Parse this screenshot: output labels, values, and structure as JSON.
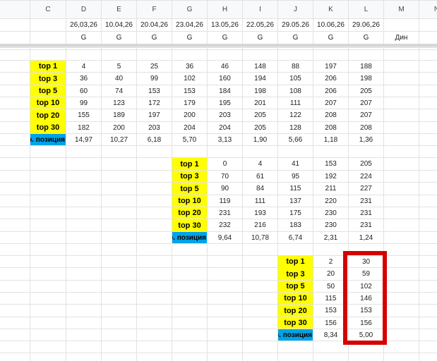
{
  "columns": [
    "C",
    "D",
    "E",
    "F",
    "G",
    "H",
    "I",
    "J",
    "K",
    "L",
    "M",
    "N"
  ],
  "dates": [
    "26,03,26",
    "10.04,26",
    "20.04,26",
    "23.04,26",
    "13.05,26",
    "22.05,26",
    "29.05.26",
    "10.06,26",
    "29.06,26"
  ],
  "engine_row": [
    "G",
    "G",
    "G",
    "G",
    "G",
    "G",
    "G",
    "G",
    "G"
  ],
  "dyn_label": "Дин",
  "labels": [
    "top 1",
    "top 3",
    "top 5",
    "top 10",
    "top 20",
    "top 30"
  ],
  "avg_label": "Ср. позиция",
  "block1": {
    "rows": [
      [
        "4",
        "5",
        "25",
        "36",
        "46",
        "148",
        "88",
        "197",
        "188"
      ],
      [
        "36",
        "40",
        "99",
        "102",
        "160",
        "194",
        "105",
        "206",
        "198"
      ],
      [
        "60",
        "74",
        "153",
        "153",
        "184",
        "198",
        "108",
        "206",
        "205"
      ],
      [
        "99",
        "123",
        "172",
        "179",
        "195",
        "201",
        "111",
        "207",
        "207"
      ],
      [
        "155",
        "189",
        "197",
        "200",
        "203",
        "205",
        "122",
        "208",
        "207"
      ],
      [
        "182",
        "200",
        "203",
        "204",
        "204",
        "205",
        "128",
        "208",
        "208"
      ]
    ],
    "avg": [
      "14,97",
      "10,27",
      "6,18",
      "5,70",
      "3,13",
      "1,90",
      "5,66",
      "1,18",
      "1,36"
    ]
  },
  "block2": {
    "rows": [
      [
        "0",
        "4",
        "41",
        "153",
        "205"
      ],
      [
        "70",
        "61",
        "95",
        "192",
        "224"
      ],
      [
        "90",
        "84",
        "115",
        "211",
        "227"
      ],
      [
        "119",
        "111",
        "137",
        "220",
        "231"
      ],
      [
        "231",
        "193",
        "175",
        "230",
        "231"
      ],
      [
        "232",
        "216",
        "183",
        "230",
        "231"
      ]
    ],
    "avg": [
      "9,64",
      "10,78",
      "6,74",
      "2,31",
      "1,24"
    ]
  },
  "block3": {
    "rows": [
      [
        "2",
        "30"
      ],
      [
        "20",
        "59"
      ],
      [
        "50",
        "102"
      ],
      [
        "115",
        "146"
      ],
      [
        "153",
        "153"
      ],
      [
        "156",
        "156"
      ]
    ],
    "avg": [
      "8,34",
      "5,00"
    ]
  },
  "colors": {
    "label_fill": "#ffff00",
    "avg_fill": "#00a3e8",
    "highlight_border": "#d50000"
  }
}
